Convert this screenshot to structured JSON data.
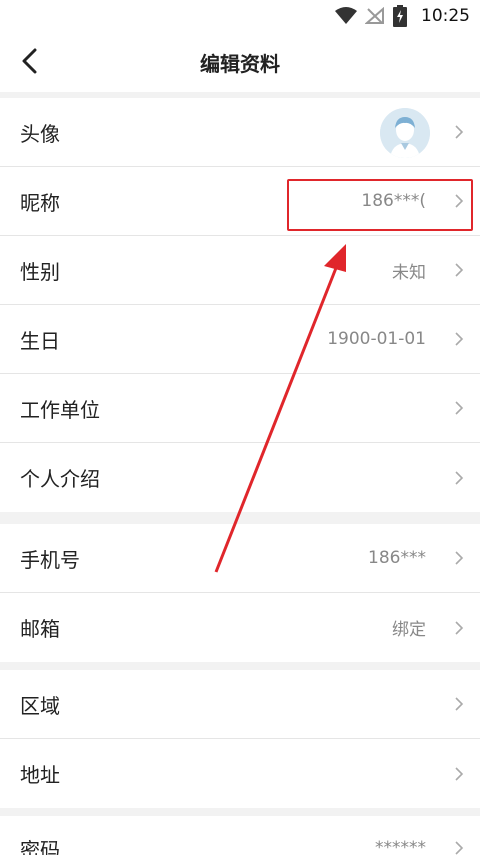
{
  "status_bar": {
    "time": "10:25"
  },
  "header": {
    "title": "编辑资料"
  },
  "sections": [
    {
      "rows": [
        {
          "label": "头像",
          "value": "",
          "type": "avatar"
        },
        {
          "label": "昵称",
          "value": "186***("
        },
        {
          "label": "性别",
          "value": "未知"
        },
        {
          "label": "生日",
          "value": "1900-01-01"
        },
        {
          "label": "工作单位",
          "value": ""
        },
        {
          "label": "个人介绍",
          "value": ""
        }
      ]
    },
    {
      "rows": [
        {
          "label": "手机号",
          "value": "186***"
        },
        {
          "label": "邮箱",
          "value": "绑定"
        }
      ]
    },
    {
      "rows": [
        {
          "label": "区域",
          "value": ""
        },
        {
          "label": "地址",
          "value": ""
        }
      ]
    },
    {
      "rows": [
        {
          "label": "密码",
          "value": "******"
        }
      ]
    }
  ],
  "colors": {
    "annotation": "#e0262b",
    "value_text": "#888888",
    "background": "#f2f2f2"
  },
  "icons": {
    "back": "chevron-left-icon",
    "row_arrow": "chevron-right-icon",
    "wifi": "wifi-icon",
    "signal": "no-signal-icon",
    "battery": "battery-charging-icon"
  }
}
